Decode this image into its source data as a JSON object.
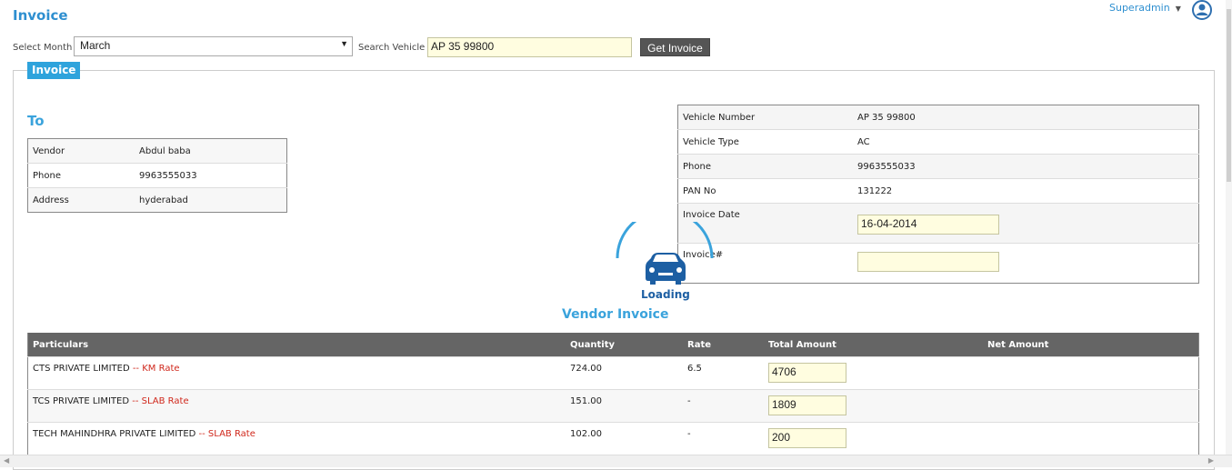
{
  "header": {
    "title": "Invoice",
    "user_name": "Superadmin"
  },
  "filters": {
    "month_label": "Select Month",
    "month_value": "March",
    "vehicle_label": "Search Vehicle",
    "vehicle_value": "AP 35 99800",
    "get_invoice_label": "Get Invoice"
  },
  "panel": {
    "tab_label": "Invoice"
  },
  "to_section": {
    "heading": "To",
    "rows": [
      {
        "label": "Vendor",
        "value": "Abdul baba"
      },
      {
        "label": "Phone",
        "value": "9963555033"
      },
      {
        "label": "Address",
        "value": "hyderabad"
      }
    ]
  },
  "vehicle_section": {
    "rows": [
      {
        "label": "Vehicle Number",
        "value": "AP 35 99800"
      },
      {
        "label": "Vehicle Type",
        "value": "AC"
      },
      {
        "label": "Phone",
        "value": "9963555033"
      },
      {
        "label": "PAN No",
        "value": "131222"
      }
    ],
    "invoice_date_label": "Invoice Date",
    "invoice_date_value": "16-04-2014",
    "invoice_no_label": "Invoice#",
    "invoice_no_value": ""
  },
  "loader": {
    "text": "Loading"
  },
  "vendor_invoice": {
    "title": "Vendor Invoice",
    "columns": [
      "Particulars",
      "Quantity",
      "Rate",
      "Total Amount",
      "Net Amount"
    ],
    "rows": [
      {
        "company": "CTS PRIVATE LIMITED",
        "rate_type": "-- KM Rate",
        "quantity": "724.00",
        "rate": "6.5",
        "total": "4706"
      },
      {
        "company": "TCS PRIVATE LIMITED",
        "rate_type": "-- SLAB Rate",
        "quantity": "151.00",
        "rate": "-",
        "total": "1809"
      },
      {
        "company": "TECH MAHINDHRA PRIVATE LIMITED",
        "rate_type": "-- SLAB Rate",
        "quantity": "102.00",
        "rate": "-",
        "total": "200"
      }
    ]
  },
  "colors": {
    "accent": "#2ea3dc",
    "header_row": "#656565",
    "input_bg": "#fffde0",
    "rate_type": "#d0281c"
  }
}
